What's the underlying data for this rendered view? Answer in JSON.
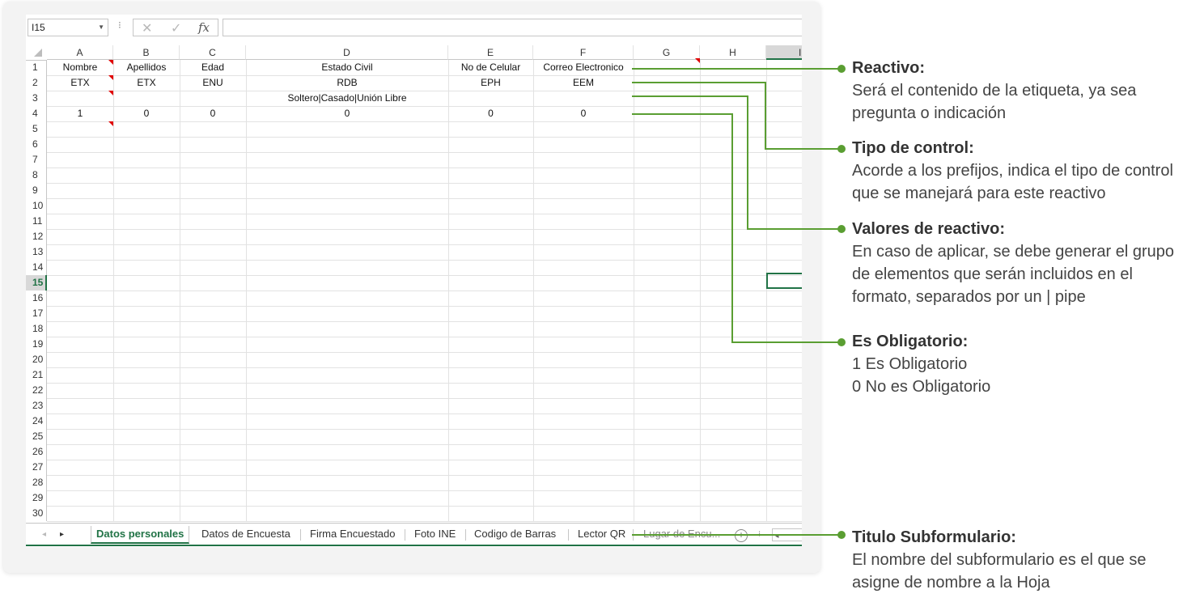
{
  "formula_bar": {
    "name_box": "I15",
    "dots": "⁝",
    "cancel_icon": "✕",
    "enter_icon": "✓",
    "fx_label": "fx",
    "formula": ""
  },
  "grid": {
    "columns": [
      "A",
      "B",
      "C",
      "D",
      "E",
      "F",
      "G",
      "H",
      "I"
    ],
    "selected_column": "I",
    "rows": [
      "1",
      "2",
      "3",
      "4",
      "5",
      "6",
      "7",
      "8",
      "9",
      "10",
      "11",
      "12",
      "13",
      "14",
      "15",
      "16",
      "17",
      "18",
      "19",
      "20",
      "21",
      "22",
      "23",
      "24",
      "25",
      "26",
      "27",
      "28",
      "29",
      "30"
    ],
    "selected_row": "15",
    "cells": {
      "row1": [
        "Nombre",
        "Apellidos",
        "Edad",
        "Estado Civil",
        "No de Celular",
        "Correo Electronico"
      ],
      "row2": [
        "ETX",
        "ETX",
        "ENU",
        "RDB",
        "EPH",
        "EEM"
      ],
      "row3_d": "Soltero|Casado|Unión Libre",
      "row4": [
        "1",
        "0",
        "0",
        "0",
        "0",
        "0"
      ]
    }
  },
  "sheet_tabs": {
    "tabs": [
      "Datos personales",
      "Datos de Encuesta",
      "Firma Encuestado",
      "Foto INE",
      "Codigo de Barras",
      "Lector QR",
      "Lugar de Encu..."
    ],
    "active_index": 0,
    "nav_prev": "◂",
    "nav_next": "▸",
    "add_icon": "+",
    "more_dots": "⁝",
    "scroll_left": "◂"
  },
  "annotations": [
    {
      "title": "Reactivo:",
      "lines": [
        "Será el contenido de la etiqueta, ya sea",
        "pregunta o indicación"
      ]
    },
    {
      "title": "Tipo de control:",
      "lines": [
        "Acorde a los prefijos, indica el tipo de control",
        "que se manejará para este reactivo"
      ]
    },
    {
      "title": "Valores de reactivo:",
      "lines": [
        "En caso de aplicar, se debe generar el grupo",
        "de elementos que serán incluidos en el",
        "formato, separados por un | pipe"
      ]
    },
    {
      "title": "Es Obligatorio:",
      "lines": [
        "1 Es Obligatorio",
        "0 No es Obligatorio"
      ]
    },
    {
      "title": "Titulo Subformulario:",
      "lines": [
        "El nombre del subformulario es el que se",
        "asigne de nombre a la Hoja"
      ]
    }
  ],
  "colors": {
    "accent": "#5a9e32",
    "excel_green": "#217346",
    "comment_marker": "#e00000"
  }
}
